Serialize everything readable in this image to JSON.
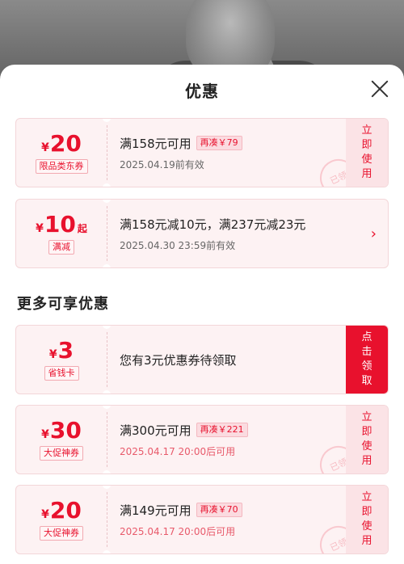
{
  "header": {
    "title": "优惠"
  },
  "section_more": {
    "title": "更多可享优惠"
  },
  "coupons": [
    {
      "yen": "¥",
      "amount": "20",
      "suffix": "",
      "tag": "限品类东券",
      "condition": "满158元可用",
      "extra": "再凑￥79",
      "validity": "2025.04.19前有效",
      "action_line1": "立即",
      "action_line2": "使用",
      "stamp": "已领"
    },
    {
      "yen": "¥",
      "amount": "10",
      "suffix": "起",
      "tag": "满减",
      "condition": "满158元减10元，满237元减23元",
      "validity": "2025.04.30 23:59前有效",
      "arrow": "›"
    },
    {
      "yen": "¥",
      "amount": "3",
      "suffix": "",
      "tag": "省钱卡",
      "condition": "您有3元优惠券待领取",
      "action_line1": "点击",
      "action_line2": "领取"
    },
    {
      "yen": "¥",
      "amount": "30",
      "suffix": "",
      "tag": "大促神券",
      "condition": "满300元可用",
      "extra": "再凑￥221",
      "validity": "2025.04.17 20:00后可用",
      "action_line1": "立即",
      "action_line2": "使用",
      "stamp": "已领"
    },
    {
      "yen": "¥",
      "amount": "20",
      "suffix": "",
      "tag": "大促神券",
      "condition": "满149元可用",
      "extra": "再凑￥70",
      "validity": "2025.04.17 20:00后可用",
      "action_line1": "立即",
      "action_line2": "使用",
      "stamp": "已领"
    }
  ],
  "colors": {
    "accent": "#e8112d",
    "card_bg": "#fdf2f3",
    "overlay": "#6a6a6a"
  }
}
